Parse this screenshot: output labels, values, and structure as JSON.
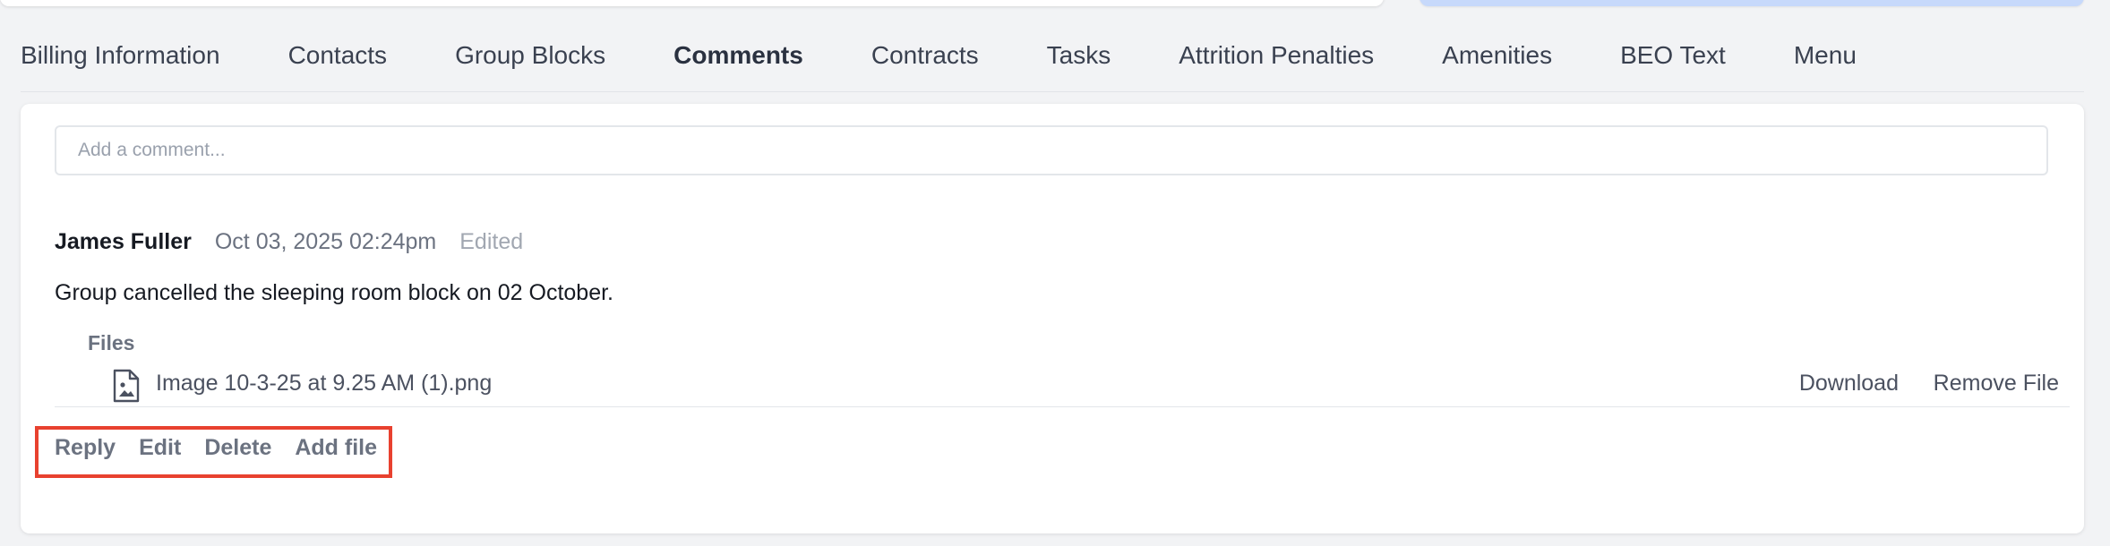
{
  "tabs": [
    {
      "label": "Billing Information",
      "active": false
    },
    {
      "label": "Contacts",
      "active": false
    },
    {
      "label": "Group Blocks",
      "active": false
    },
    {
      "label": "Comments",
      "active": true
    },
    {
      "label": "Contracts",
      "active": false
    },
    {
      "label": "Tasks",
      "active": false
    },
    {
      "label": "Attrition Penalties",
      "active": false
    },
    {
      "label": "Amenities",
      "active": false
    },
    {
      "label": "BEO Text",
      "active": false
    },
    {
      "label": "Menu",
      "active": false
    }
  ],
  "comment_input": {
    "placeholder": "Add a comment...",
    "value": ""
  },
  "comment": {
    "author": "James Fuller",
    "timestamp": "Oct 03, 2025 02:24pm",
    "edited_label": "Edited",
    "body": "Group cancelled the sleeping room block on 02 October.",
    "files_heading": "Files",
    "files": [
      {
        "name": "Image 10-3-25 at 9.25 AM (1).png",
        "icon": "image-file-icon",
        "download_label": "Download",
        "remove_label": "Remove File"
      }
    ],
    "actions": {
      "reply": "Reply",
      "edit": "Edit",
      "delete": "Delete",
      "add_file": "Add file"
    }
  },
  "colors": {
    "highlight_border": "#e8412f",
    "banner": "#c7d9fb",
    "background": "#f2f3f5"
  }
}
